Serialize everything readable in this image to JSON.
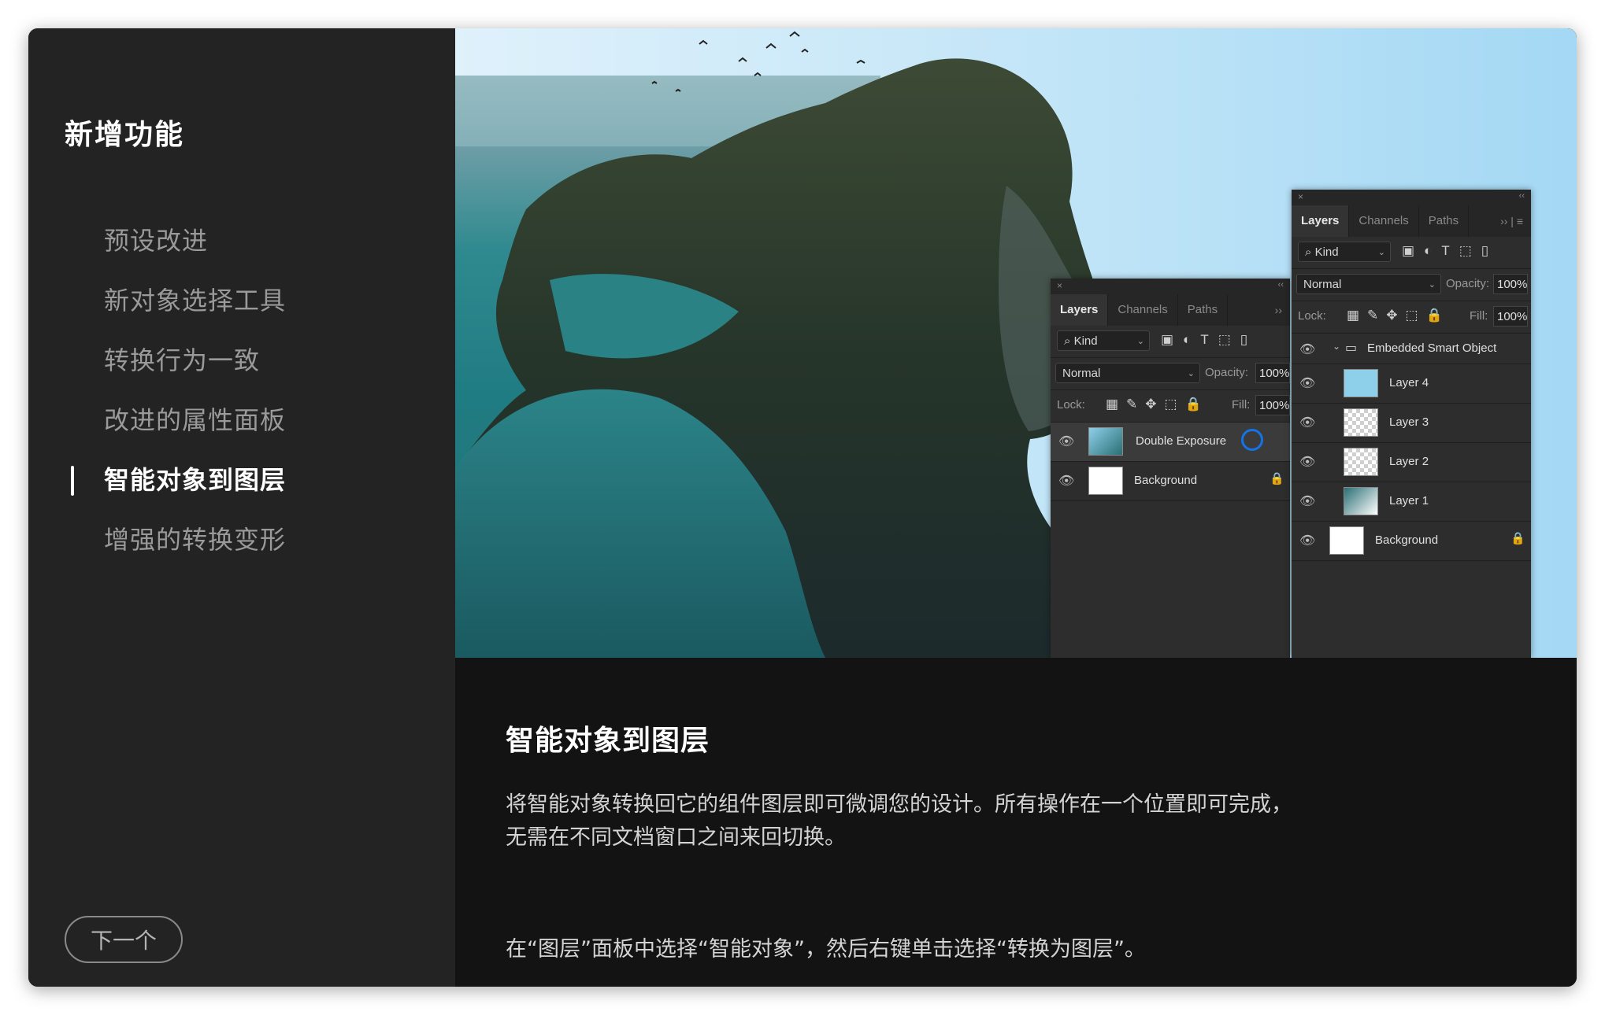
{
  "sidebar": {
    "title": "新增功能",
    "items": [
      {
        "label": "预设改进"
      },
      {
        "label": "新对象选择工具"
      },
      {
        "label": "转换行为一致"
      },
      {
        "label": "改进的属性面板"
      },
      {
        "label": "智能对象到图层"
      },
      {
        "label": "增强的转换变形"
      }
    ],
    "active_index": 4,
    "next_label": "下一个"
  },
  "caption": {
    "title": "智能对象到图层",
    "line1": "将智能对象转换回它的组件图层即可微调您的设计。所有操作在一个位置即可完成，",
    "line2": "无需在不同文档窗口之间来回切换。",
    "instruction": "在“图层”面板中选择“智能对象”，然后右键单击选择“转换为图层”。"
  },
  "panel_left": {
    "tabs": [
      "Layers",
      "Channels",
      "Paths"
    ],
    "kind": "Kind",
    "blend_mode": "Normal",
    "opacity_label": "Opacity:",
    "opacity": "100%",
    "lock_label": "Lock:",
    "fill_label": "Fill:",
    "fill": "100%",
    "layers": [
      {
        "name": "Double Exposure"
      },
      {
        "name": "Background"
      }
    ]
  },
  "panel_right": {
    "tabs": [
      "Layers",
      "Channels",
      "Paths"
    ],
    "kind": "Kind",
    "blend_mode": "Normal",
    "opacity_label": "Opacity:",
    "opacity": "100%",
    "lock_label": "Lock:",
    "fill_label": "Fill:",
    "fill": "100%",
    "group": "Embedded Smart Object",
    "layers": [
      {
        "name": "Layer 4"
      },
      {
        "name": "Layer 3"
      },
      {
        "name": "Layer 2"
      },
      {
        "name": "Layer 1"
      },
      {
        "name": "Background"
      }
    ]
  },
  "colors": {
    "sidebar_bg": "#232323",
    "caption_bg": "#131313",
    "sky": "#a4d8f4",
    "sea": "#1f7c82",
    "accent_ring": "#1473e6"
  }
}
